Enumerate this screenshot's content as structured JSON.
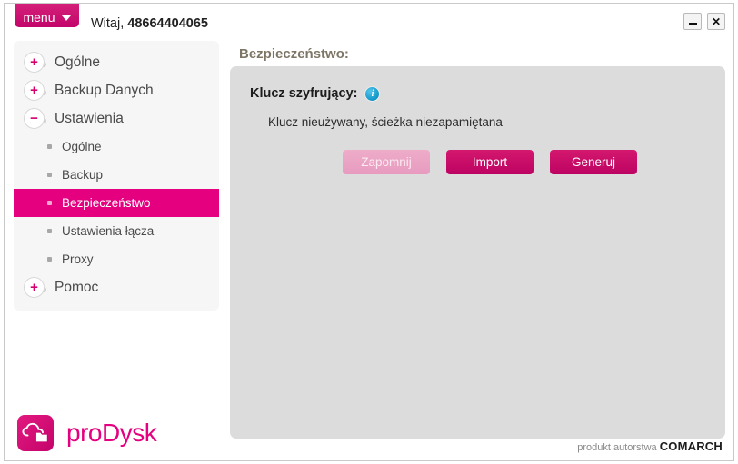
{
  "titlebar": {
    "menu_label": "menu",
    "greeting_prefix": "Witaj, ",
    "account_id": "48664404065",
    "minimize_title": "Minimalizuj",
    "close_title": "Zamknij",
    "close_glyph": "✕"
  },
  "sidebar": {
    "items": [
      {
        "label": "Ogólne",
        "type": "top",
        "state": "collapsed",
        "sign": "+"
      },
      {
        "label": "Backup Danych",
        "type": "top",
        "state": "collapsed",
        "sign": "+"
      },
      {
        "label": "Ustawienia",
        "type": "top",
        "state": "expanded",
        "sign": "−"
      },
      {
        "label": "Ogólne",
        "type": "sub",
        "selected": false
      },
      {
        "label": "Backup",
        "type": "sub",
        "selected": false
      },
      {
        "label": "Bezpieczeństwo",
        "type": "sub",
        "selected": true
      },
      {
        "label": "Ustawienia łącza",
        "type": "sub",
        "selected": false
      },
      {
        "label": "Proxy",
        "type": "sub",
        "selected": false
      },
      {
        "label": "Pomoc",
        "type": "top",
        "state": "collapsed",
        "sign": "+"
      }
    ],
    "logo_text": "proDysk",
    "logo_icon": "cloud-folder-icon"
  },
  "content": {
    "header": "Bezpieczeństwo:",
    "section_title": "Klucz szyfrujący:",
    "info_icon": "info-icon",
    "info_glyph": "i",
    "status_text": "Klucz nieużywany, ścieżka niezapamiętana",
    "buttons": [
      {
        "label": "Zapomnij",
        "state": "disabled"
      },
      {
        "label": "Import",
        "state": "enabled"
      },
      {
        "label": "Generuj",
        "state": "enabled"
      }
    ]
  },
  "footer": {
    "credit_prefix": "produkt autorstwa ",
    "credit_brand": "COMARCH"
  },
  "colors": {
    "accent": "#e4007f",
    "accent_dark": "#bd0362",
    "accent_light": "#eeacc9",
    "panel": "#dcdcdc",
    "sidebar_panel": "#f6f6f6",
    "header_text": "#7d7566",
    "info_blue": "#1097c9"
  }
}
